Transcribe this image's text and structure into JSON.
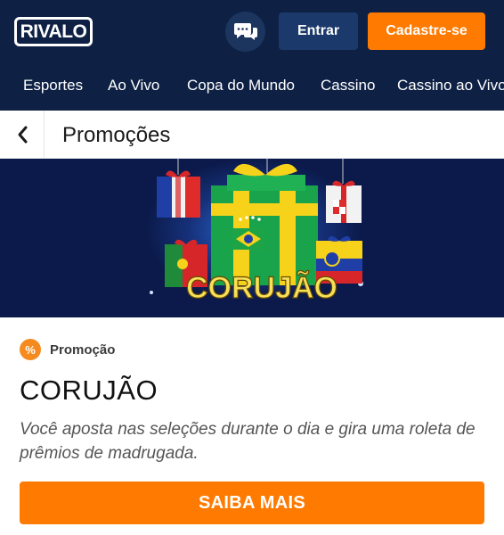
{
  "header": {
    "logo_text": "RIVALO",
    "login_label": "Entrar",
    "signup_label": "Cadastre-se",
    "chat_icon": "chat-bubbles-icon"
  },
  "nav": {
    "items": [
      {
        "label": "Esportes"
      },
      {
        "label": "Ao Vivo"
      },
      {
        "label": "Copa do Mundo"
      },
      {
        "label": "Cassino"
      },
      {
        "label": "Cassino ao Vivo"
      }
    ]
  },
  "page": {
    "title": "Promoções",
    "back_icon": "chevron-left-icon"
  },
  "banner": {
    "headline": "CORUJÃO"
  },
  "promo": {
    "tag": "Promoção",
    "tag_icon_glyph": "%",
    "title": "CORUJÃO",
    "description": "Você aposta nas seleções durante o dia e gira uma roleta de prêmios de madrugada.",
    "cta_label": "SAIBA MAIS"
  },
  "colors": {
    "header_bg": "#0e2145",
    "accent_orange": "#ff7a00",
    "login_bg": "#1b3a6b"
  }
}
